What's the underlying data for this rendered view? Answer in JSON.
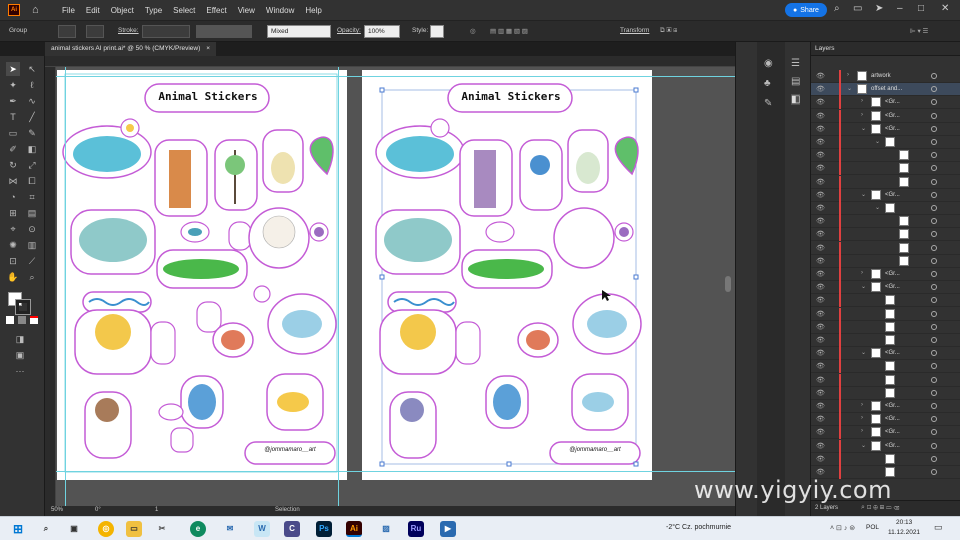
{
  "app": {
    "logo": "Ai",
    "menu": [
      "File",
      "Edit",
      "Object",
      "Type",
      "Select",
      "Effect",
      "View",
      "Window",
      "Help"
    ],
    "share_label": "Share"
  },
  "control_bar": {
    "selection_type": "Group",
    "stroke_label": "Stroke:",
    "blend_mode": "Mixed",
    "opacity_label": "Opacity:",
    "opacity_value": "100%",
    "style_label": "Style:",
    "transform_label": "Transform"
  },
  "document": {
    "tab_title": "animal stickers AI print.ai* @ 50 % (CMYK/Preview)",
    "close_glyph": "×"
  },
  "artboards": [
    {
      "title": "Animal Stickers",
      "signature": "@jommamaro__art"
    },
    {
      "title": "Animal Stickers",
      "signature": "@jommamaro__art"
    }
  ],
  "status_bar": {
    "zoom": "50%",
    "rotation": "0°",
    "page": "1",
    "tool": "Selection"
  },
  "layers_panel": {
    "title": "Layers",
    "footer_count": "2 Layers",
    "rows": [
      {
        "name": "artwork",
        "level": 0,
        "expanded": false
      },
      {
        "name": "offset and...",
        "level": 0,
        "expanded": true,
        "selected": true
      },
      {
        "name": "<Gr...",
        "level": 1,
        "expanded": false
      },
      {
        "name": "<Gr...",
        "level": 1,
        "expanded": false
      },
      {
        "name": "<Gr...",
        "level": 1,
        "expanded": true
      },
      {
        "name": "",
        "level": 2,
        "expanded": true
      },
      {
        "name": "",
        "level": 3
      },
      {
        "name": "",
        "level": 3
      },
      {
        "name": "",
        "level": 3
      },
      {
        "name": "<Gr...",
        "level": 1,
        "expanded": true
      },
      {
        "name": "",
        "level": 2,
        "expanded": true
      },
      {
        "name": "",
        "level": 3
      },
      {
        "name": "",
        "level": 3
      },
      {
        "name": "",
        "level": 3
      },
      {
        "name": "",
        "level": 3
      },
      {
        "name": "<Gr...",
        "level": 1,
        "expanded": false
      },
      {
        "name": "<Gr...",
        "level": 1,
        "expanded": true
      },
      {
        "name": "",
        "level": 2
      },
      {
        "name": "",
        "level": 2
      },
      {
        "name": "",
        "level": 2
      },
      {
        "name": "",
        "level": 2
      },
      {
        "name": "<Gr...",
        "level": 1,
        "expanded": true
      },
      {
        "name": "",
        "level": 2
      },
      {
        "name": "",
        "level": 2
      },
      {
        "name": "",
        "level": 2
      },
      {
        "name": "<Gr...",
        "level": 1,
        "expanded": false
      },
      {
        "name": "<Gr...",
        "level": 1,
        "expanded": false
      },
      {
        "name": "<Gr...",
        "level": 1,
        "expanded": false
      },
      {
        "name": "<Gr...",
        "level": 1,
        "expanded": true
      },
      {
        "name": "",
        "level": 2
      },
      {
        "name": "",
        "level": 2
      }
    ]
  },
  "taskbar": {
    "weather": "-2°C  Cz. pochmurnie",
    "language": "POL",
    "time": "20:13",
    "date": "11.12.2021"
  },
  "watermark": "www.yigyiy.com",
  "colors": {
    "accent": "#1473e6",
    "ai_orange": "#ff7c00",
    "guide_cyan": "#6fd3e0",
    "sticker_outline": "#c45cd6",
    "layer_red": "#e04040"
  }
}
